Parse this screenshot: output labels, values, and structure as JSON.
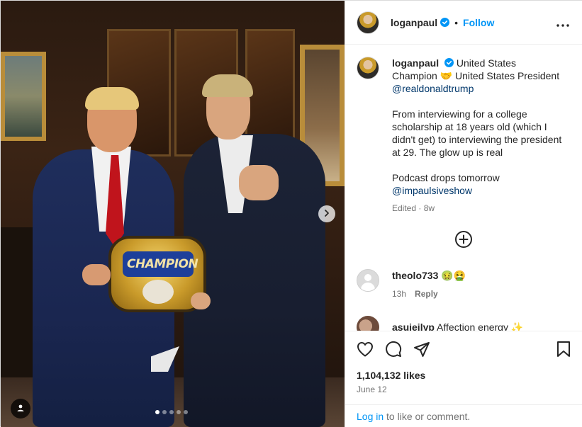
{
  "post": {
    "username": "loganpaul",
    "follow_label": "Follow",
    "separator": "•",
    "photo": {
      "belt_text": "CHAMPION",
      "carousel": {
        "total": 5,
        "active": 0
      }
    }
  },
  "caption": {
    "username": "loganpaul",
    "text_1": "United States Champion 🤝 United States President ",
    "mention_1": "@realdonaldtrump",
    "text_2": "From interviewing for a college scholarship at 18 years old (which I didn't get) to interviewing the president at 29. The glow up is real",
    "text_3": "Podcast drops tomorrow",
    "mention_2": "@impaulsiveshow",
    "meta": "Edited · 8w"
  },
  "comments": [
    {
      "username": "theolo733",
      "text": "🤢🤮",
      "time": "13h",
      "reply_label": "Reply"
    },
    {
      "username": "asujeilyp",
      "text": "Affection energy ✨"
    }
  ],
  "stats": {
    "likes": "1,104,132 likes",
    "date": "June 12"
  },
  "login": {
    "link": "Log in",
    "text": " to like or comment."
  },
  "colors": {
    "accent": "#0095f6",
    "text": "#262626",
    "muted": "#737373",
    "mention": "#00376b"
  },
  "icons": [
    "verified-badge-icon",
    "more-options-icon",
    "next-arrow-icon",
    "user-tag-icon",
    "load-more-icon",
    "heart-icon",
    "comment-icon",
    "share-icon",
    "bookmark-icon"
  ]
}
